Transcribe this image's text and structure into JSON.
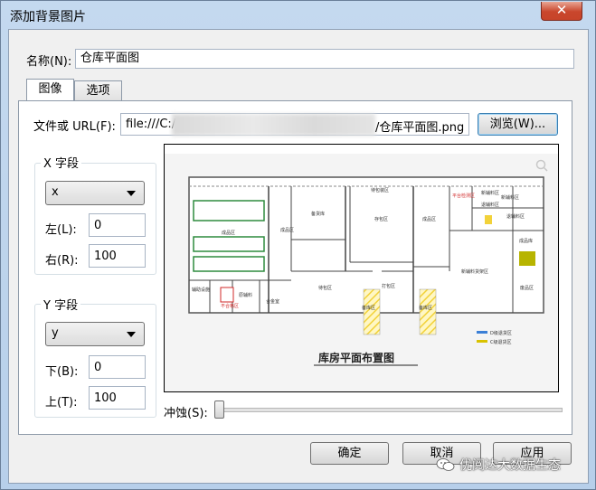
{
  "window": {
    "title": "添加背景图片",
    "close_symbol": "✕"
  },
  "name_field": {
    "label": "名称(N):",
    "value": "仓库平面图"
  },
  "tabs": [
    {
      "label": "图像",
      "active": true
    },
    {
      "label": "选项",
      "active": false
    }
  ],
  "file_field": {
    "label": "文件或 URL(F):",
    "value_start": "file:///C:/",
    "value_end": "/仓库平面图.png",
    "browse_label": "浏览(W)..."
  },
  "x_group": {
    "title": "X 字段",
    "selected": "x",
    "left": {
      "label": "左(L):",
      "value": "0"
    },
    "right": {
      "label": "右(R):",
      "value": "100"
    }
  },
  "y_group": {
    "title": "Y 字段",
    "selected": "y",
    "bottom": {
      "label": "下(B):",
      "value": "0"
    },
    "top": {
      "label": "上(T):",
      "value": "100"
    }
  },
  "preview": {
    "caption": "库房平面布置图",
    "rooms": [
      "成品区",
      "成品区",
      "备货库",
      "存包区",
      "待包装区",
      "成品区",
      "平台检测区",
      "新辅料区",
      "新辅料区",
      "退辅料区",
      "退辅料区",
      "新辅料货架区",
      "成品库",
      "合金室",
      "待包区",
      "打包区",
      "备库区",
      "备库区",
      "辅助设施",
      "原辅料",
      "不合格区",
      "废品区"
    ],
    "legend": [
      "D级退货区",
      "C级退货区"
    ],
    "colors": {
      "green_outline": "#2e8b3e",
      "hatch_yellow": "#f2d23a",
      "legend_blue": "#3b7fd6",
      "legend_yellow": "#d9c200",
      "highlight_olive": "#b7b400",
      "red_label": "#d12a2a"
    }
  },
  "opacity": {
    "label": "冲蚀(S):",
    "value": 0
  },
  "buttons": {
    "ok": "确定",
    "cancel": "取消",
    "apply": "应用"
  },
  "watermark": "优阅达大数据生态",
  "colors": {
    "titlebar": "#c4d9ef",
    "close_button": "#c9462c",
    "dialog_bg": "#f0f0f0",
    "default_button_border": "#3c7fb1"
  }
}
